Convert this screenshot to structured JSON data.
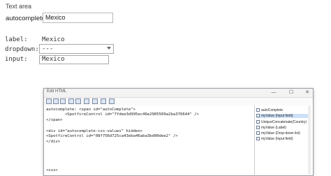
{
  "section_title": "Text area",
  "autocomplete": {
    "label": "autocomplete:",
    "value": "Mexico"
  },
  "form": {
    "label_label": "label:",
    "label_value": "Mexico",
    "dropdown_label": "dropdown:",
    "dropdown_value": "---",
    "input_label": "input:",
    "input_value": "Mexico"
  },
  "window": {
    "title": "Edit HTML",
    "buttons": {
      "minimize": "—",
      "maximize": "☐",
      "close": "✕"
    }
  },
  "code_lines": [
    "autocomplete: <span id=\"autoComplete\">",
    "        <SpotfireControl id=\"7fdee3d995ec46e2905509a2ba376644\" />",
    "</span>",
    "",
    "<div id=\"autocomplete-css-values\" hidden>",
    "<SpotfireControl id=\"08f756d725ca43eba46aba3bd00dee2\" />",
    "</div>",
    "",
    "",
    "",
    "<css>"
  ],
  "side_items": [
    {
      "label": "autoComplete",
      "selected": false
    },
    {
      "label": "myValue (Input field)",
      "selected": true
    },
    {
      "label": "UniqueConcatenate(Country)",
      "selected": false
    },
    {
      "label": "myValue (Label)",
      "selected": false
    },
    {
      "label": "myValue (Drop-down list)",
      "selected": false
    },
    {
      "label": "myValue (Input field)",
      "selected": false
    }
  ]
}
